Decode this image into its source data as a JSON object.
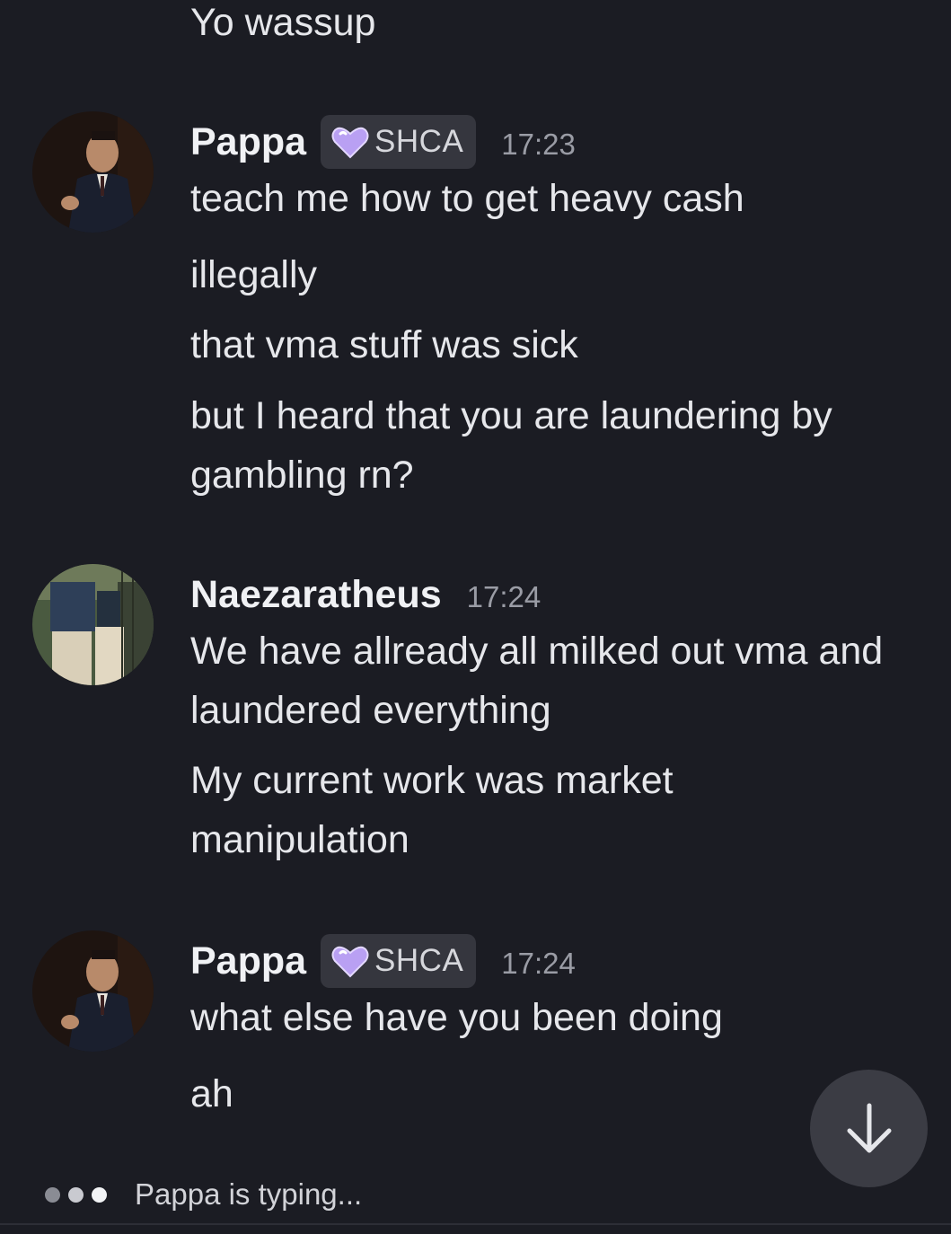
{
  "chat": {
    "top_message": "Yo wassup",
    "groups": [
      {
        "username": "Pappa",
        "tag": "SHCA",
        "timestamp": "17:23",
        "messages": [
          "teach me how to get heavy cash",
          "illegally",
          "that vma stuff was sick",
          "but I heard that you are laundering by gambling rn?"
        ]
      },
      {
        "username": "Naezaratheus",
        "timestamp": "17:24",
        "messages": [
          "We have allready all milked out vma and laundered everything",
          "My current work was market manipulation"
        ]
      },
      {
        "username": "Pappa",
        "tag": "SHCA",
        "timestamp": "17:24",
        "messages": [
          "what else have you been doing",
          "ah"
        ]
      }
    ]
  },
  "typing_indicator": "Pappa is typing...",
  "icons": {
    "tag_icon": "heart-icon",
    "scroll_button": "arrow-down-icon"
  },
  "colors": {
    "background": "#1b1c23",
    "tag_background": "#35363e",
    "heart": "#b9a0f3",
    "timestamp": "#9a9ca5"
  }
}
